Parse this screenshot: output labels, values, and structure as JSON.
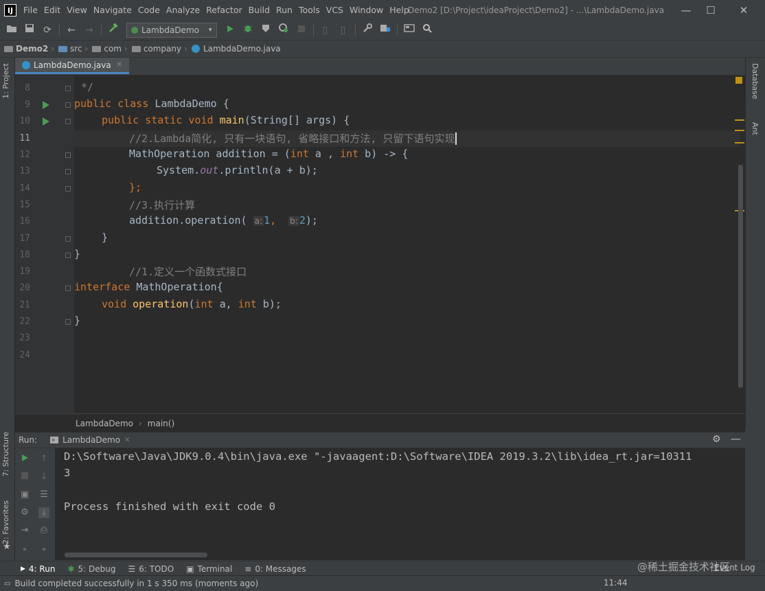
{
  "app": {
    "logo_text": "IJ",
    "window_title": "Demo2 [D:\\Project\\ideaProject\\Demo2] - ...\\LambdaDemo.java",
    "menu": [
      "File",
      "Edit",
      "View",
      "Navigate",
      "Code",
      "Analyze",
      "Refactor",
      "Build",
      "Run",
      "Tools",
      "VCS",
      "Window",
      "Help"
    ],
    "controls": {
      "minimize": "—",
      "maximize": "☐",
      "close": "✕"
    }
  },
  "toolbar": {
    "run_config": "LambdaDemo",
    "dropdown_glyph": "▾"
  },
  "breadcrumb": [
    "Demo2",
    "src",
    "com",
    "company",
    "LambdaDemo.java"
  ],
  "side_tabs": {
    "left": [
      "1: Project",
      "7: Structure",
      "2: Favorites"
    ],
    "right": [
      "Database",
      "Ant"
    ]
  },
  "editor": {
    "tab_label": "LambdaDemo.java",
    "line_numbers": [
      "8",
      "9",
      "10",
      "11",
      "12",
      "13",
      "14",
      "15",
      "16",
      "17",
      "18",
      "19",
      "20",
      "21",
      "22",
      "23",
      "24"
    ],
    "partial_top": "*/",
    "lines": {
      "l9": {
        "kw": "public class ",
        "name": "LambdaDemo {"
      },
      "l10": {
        "kw": "public static void ",
        "fn": "main",
        "rest": "(String[] args) {"
      },
      "l11": "//2.Lambda简化, 只有一块语句, 省略接口和方法, 只留下语句实现",
      "l12": {
        "type": "MathOperation addition = (",
        "kw1": "int",
        "mid": " a , ",
        "kw2": "int",
        "rest": " b) -> {"
      },
      "l13": {
        "pre": "System.",
        "field": "out",
        "rest": ".println(a + b);"
      },
      "l14": "};",
      "l15": "//3.执行计算",
      "l16": {
        "pre": "addition.operation( ",
        "hint_a": "a:",
        "val_a": "1",
        "comma": ",  ",
        "hint_b": "b:",
        "val_b": "2",
        "rest": ");"
      },
      "l17": "}",
      "l18": "}",
      "l19": "//1.定义一个函数式接口",
      "l20": {
        "kw": "interface ",
        "name": "MathOperation{"
      },
      "l21": {
        "kw": "void ",
        "fn": "operation",
        "p1": "(",
        "kw1": "int",
        "mid": " a, ",
        "kw2": "int",
        "rest": " b);"
      },
      "l22": "}"
    },
    "breadcrumb": [
      "LambdaDemo",
      "main()"
    ]
  },
  "run_panel": {
    "label": "Run:",
    "tab": "LambdaDemo",
    "console": [
      "D:\\Software\\Java\\JDK9.0.4\\bin\\java.exe \"-javaagent:D:\\Software\\IDEA 2019.3.2\\lib\\idea_rt.jar=10311",
      "3",
      "",
      "Process finished with exit code 0"
    ]
  },
  "tool_tabs": [
    "4: Run",
    "5: Debug",
    "6: TODO",
    "Terminal",
    "0: Messages"
  ],
  "status": {
    "message": "Build completed successfully in 1 s 350 ms (moments ago)",
    "time": "11:44",
    "event_log": "Event Log",
    "watermark": "@稀土掘金技术社区"
  }
}
